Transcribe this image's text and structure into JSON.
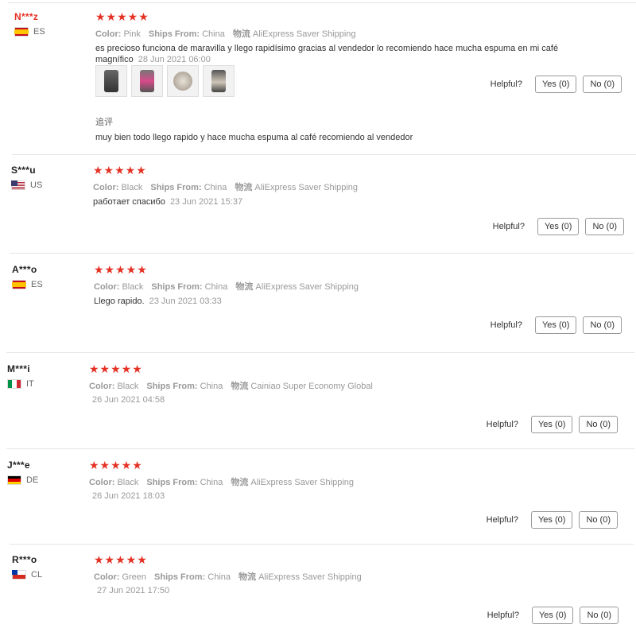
{
  "labels": {
    "color": "Color:",
    "ships_from": "Ships From:",
    "logistics": "物流",
    "helpful": "Helpful?",
    "stars": "★★★★★"
  },
  "colors": {
    "accent": "#e43225",
    "muted": "#999999",
    "text": "#333333"
  },
  "reviews": [
    {
      "name": "N***z",
      "country": "ES",
      "flag_icon": "spain-flag-icon",
      "rating": 5,
      "color": "Pink",
      "ships_from": "China",
      "shipping": "AliExpress Saver Shipping",
      "text": "es precioso funciona de maravilla y llego rapidísimo gracias al vendedor lo recomiendo hace mucha espuma en mi café magnífico",
      "date": "28 Jun 2021 06:00",
      "photos": [
        "photo-1",
        "photo-2",
        "photo-3",
        "photo-4"
      ],
      "followup_label": "追评",
      "followup_text": "muy bien todo llego rapido y hace mucha espuma al café recomiendo al vendedor",
      "yes": "Yes (0)",
      "no": "No (0)"
    },
    {
      "name": "S***u",
      "country": "US",
      "flag_icon": "usa-flag-icon",
      "rating": 5,
      "color": "Black",
      "ships_from": "China",
      "shipping": "AliExpress Saver Shipping",
      "text": "работает спасибо",
      "date": "23 Jun 2021 15:37",
      "yes": "Yes (0)",
      "no": "No (0)"
    },
    {
      "name": "A***o",
      "country": "ES",
      "flag_icon": "spain-flag-icon",
      "rating": 5,
      "color": "Black",
      "ships_from": "China",
      "shipping": "AliExpress Saver Shipping",
      "text": "Llego rapido.",
      "date": "23 Jun 2021 03:33",
      "yes": "Yes (0)",
      "no": "No (0)"
    },
    {
      "name": "M***i",
      "country": "IT",
      "flag_icon": "italy-flag-icon",
      "rating": 5,
      "color": "Black",
      "ships_from": "China",
      "shipping": "Cainiao Super Economy Global",
      "date": "26 Jun 2021 04:58",
      "yes": "Yes (0)",
      "no": "No (0)"
    },
    {
      "name": "J***e",
      "country": "DE",
      "flag_icon": "germany-flag-icon",
      "rating": 5,
      "color": "Black",
      "ships_from": "China",
      "shipping": "AliExpress Saver Shipping",
      "date": "26 Jun 2021 18:03",
      "yes": "Yes (0)",
      "no": "No (0)"
    },
    {
      "name": "R***o",
      "country": "CL",
      "flag_icon": "chile-flag-icon",
      "rating": 5,
      "color": "Green",
      "ships_from": "China",
      "shipping": "AliExpress Saver Shipping",
      "date": "27 Jun 2021 17:50",
      "yes": "Yes (0)",
      "no": "No (0)"
    }
  ]
}
